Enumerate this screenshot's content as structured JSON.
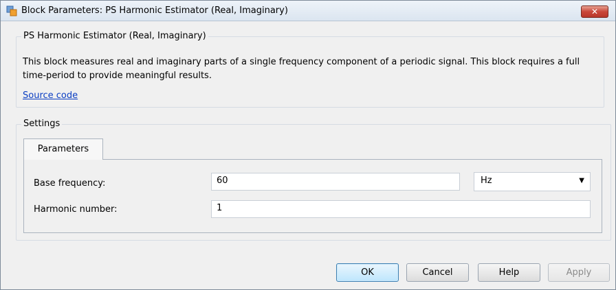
{
  "window": {
    "title": "Block Parameters: PS Harmonic Estimator (Real, Imaginary)",
    "close_label": "✕"
  },
  "block": {
    "group_title": "PS Harmonic Estimator (Real, Imaginary)",
    "description": "This block measures real and imaginary parts of a single frequency component of a periodic signal. This block requires a full time-period to provide meaningful results.",
    "source_link": "Source code"
  },
  "settings": {
    "group_title": "Settings",
    "tabs": [
      {
        "label": "Parameters",
        "active": true
      }
    ],
    "params": {
      "base_frequency": {
        "label": "Base frequency:",
        "value": "60",
        "unit": "Hz"
      },
      "harmonic_number": {
        "label": "Harmonic number:",
        "value": "1"
      }
    }
  },
  "buttons": {
    "ok": "OK",
    "cancel": "Cancel",
    "help": "Help",
    "apply": "Apply"
  },
  "icons": {
    "app": "simulink-block-icon",
    "close": "close-icon",
    "dropdown": "chevron-down-icon"
  },
  "colors": {
    "link": "#0a3dc2",
    "close_button": "#c9473a",
    "default_button_border": "#3c7fb1"
  }
}
